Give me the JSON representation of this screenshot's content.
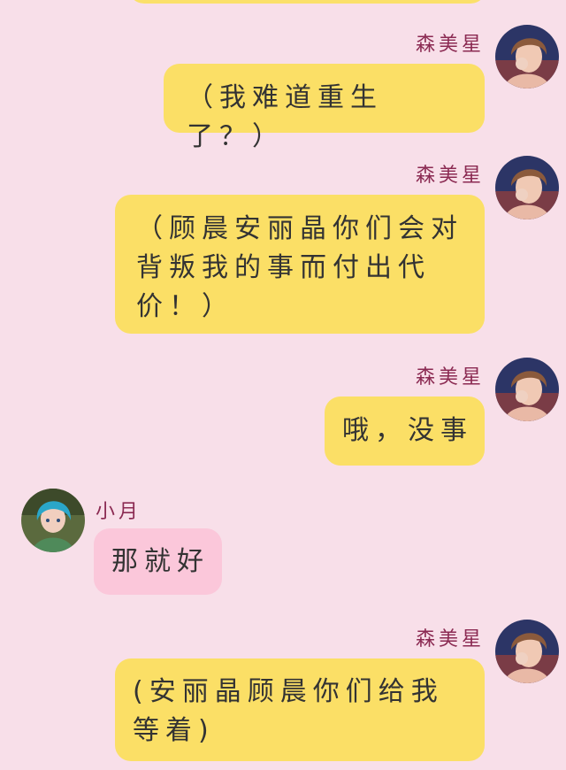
{
  "messages": [
    {
      "sender": "森美星",
      "side": "right",
      "text": "（我难道重生了？）"
    },
    {
      "sender": "森美星",
      "side": "right",
      "text": "（顾晨安丽晶你们会对背叛我的事而付出代价！）"
    },
    {
      "sender": "森美星",
      "side": "right",
      "text": "哦，没事"
    },
    {
      "sender": "小月",
      "side": "left",
      "text": "那就好"
    },
    {
      "sender": "森美星",
      "side": "right",
      "text": "(安丽晶顾晨你们给我等着)"
    }
  ],
  "colors": {
    "background": "#f8dfe9",
    "self_bubble": "#fbdf66",
    "other_bubble": "#fbc7da",
    "sender_name": "#8b2a52"
  },
  "icons": {
    "self_avatar": "avatar-senmeixing-icon",
    "other_avatar": "avatar-xiaoyue-icon"
  }
}
